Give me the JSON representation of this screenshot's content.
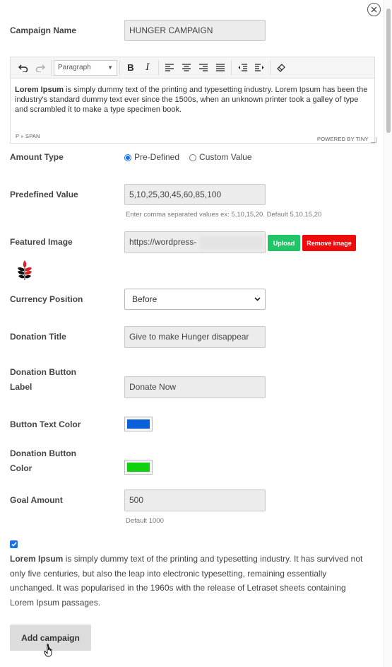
{
  "close_icon": "close-icon",
  "campaign_name": {
    "label": "Campaign Name",
    "value": "HUNGER CAMPAIGN"
  },
  "editor": {
    "format_select": "Paragraph",
    "body_bold": "Lorem Ipsum",
    "body_text": " is simply dummy text of the printing and typesetting industry. Lorem Ipsum has been the industry's standard dummy text ever since the 1500s, when an unknown printer took a galley of type and scrambled it to make a type specimen book.",
    "path": "P » SPAN",
    "powered_by": "POWERED BY TINY"
  },
  "amount_type": {
    "label": "Amount Type",
    "option1": "Pre-Defined",
    "option2": "Custom Value",
    "selected": "Pre-Defined"
  },
  "predefined_value": {
    "label": "Predefined Value",
    "value": "5,10,25,30,45,60,85,100",
    "hint": "Enter comma separated values ex: 5,10,15,20. Default 5,10,15,20"
  },
  "featured_image": {
    "label": "Featured Image",
    "value": "https://wordpress-",
    "upload_label": "Upload",
    "remove_label": "Remove image"
  },
  "currency_position": {
    "label": "Currency Position",
    "value": "Before"
  },
  "donation_title": {
    "label": "Donation Title",
    "value": "Give to make Hunger disappear"
  },
  "donation_button_label": {
    "label_line1": "Donation Button",
    "label_line2": "Label",
    "value": "Donate Now"
  },
  "button_text_color": {
    "label": "Button Text Color",
    "color": "#0b5fd9"
  },
  "donation_button_color": {
    "label_line1": "Donation Button",
    "label_line2": "Color",
    "color": "#10d010"
  },
  "goal_amount": {
    "label": "Goal Amount",
    "value": "500",
    "hint": "Default 1000"
  },
  "terms": {
    "checked": true,
    "bold": "Lorem Ipsum",
    "text": " is simply dummy text of the printing and typesetting industry. It has survived not only five centuries, but also the leap into electronic typesetting, remaining essentially unchanged. It was popularised in the 1960s with the release of Letraset sheets containing Lorem Ipsum passages."
  },
  "submit": {
    "label": "Add campaign"
  }
}
